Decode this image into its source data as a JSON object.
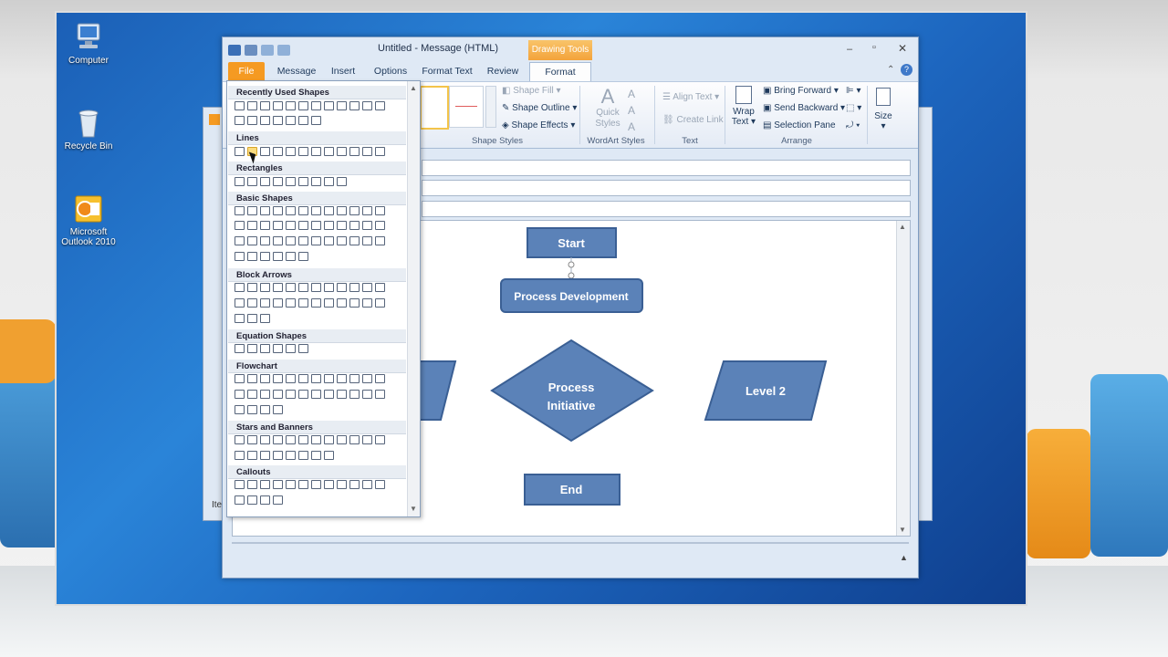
{
  "desktop": {
    "icons": [
      {
        "label": "Computer",
        "icon": "computer-icon"
      },
      {
        "label": "Recycle Bin",
        "icon": "recycle-bin-icon"
      },
      {
        "label": "Microsoft Outlook 2010",
        "icon": "outlook-icon"
      }
    ]
  },
  "window": {
    "title": "Untitled  -  Message (HTML)",
    "context_tab": "Drawing Tools",
    "tabs": [
      "File",
      "Message",
      "Insert",
      "Options",
      "Format Text",
      "Review",
      "Format"
    ],
    "active_tab": "Format"
  },
  "ribbon": {
    "shape_styles": {
      "fill": "Shape Fill",
      "outline": "Shape Outline",
      "effects": "Shape Effects",
      "label": "Shape Styles"
    },
    "wordart": {
      "quick_styles": "Quick Styles",
      "label": "WordArt Styles"
    },
    "text": {
      "align_text": "Align Text",
      "create_link": "Create Link",
      "label": "Text"
    },
    "arrange": {
      "wrap_text": "Wrap Text",
      "bring_forward": "Bring Forward",
      "send_backward": "Send Backward",
      "selection_pane": "Selection Pane",
      "label": "Arrange"
    },
    "size": {
      "label": "Size"
    }
  },
  "gallery": {
    "sections": [
      "Recently Used Shapes",
      "Lines",
      "Rectangles",
      "Basic Shapes",
      "Block Arrows",
      "Equation Shapes",
      "Flowchart",
      "Stars and Banners",
      "Callouts"
    ]
  },
  "flowchart": {
    "nodes": [
      "Start",
      "Process Development",
      "Process Initiative",
      "Level 2",
      "End"
    ],
    "fill": "#5b82b8",
    "stroke": "#3a5f94"
  },
  "status": {
    "left_text": "Ite"
  }
}
